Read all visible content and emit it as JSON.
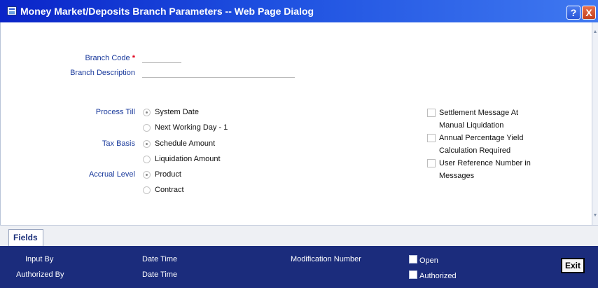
{
  "window": {
    "title": "Money Market/Deposits Branch Parameters -- Web Page Dialog",
    "help_label": "?",
    "close_label": "X"
  },
  "form": {
    "branch_code_label": "Branch Code",
    "required_marker": "*",
    "branch_code_value": "",
    "branch_description_label": "Branch Description",
    "branch_description_value": "",
    "process_till": {
      "label": "Process Till",
      "options": [
        "System Date",
        "Next Working Day - 1"
      ],
      "selected": "System Date"
    },
    "tax_basis": {
      "label": "Tax Basis",
      "options": [
        "Schedule Amount",
        "Liquidation Amount"
      ],
      "selected": "Schedule Amount"
    },
    "accrual_level": {
      "label": "Accrual Level",
      "options": [
        "Product",
        "Contract"
      ],
      "selected": "Product"
    },
    "checkboxes": [
      {
        "line1": "Settlement Message At",
        "line2": "Manual Liquidation",
        "checked": false
      },
      {
        "line1": "Annual Percentage Yield",
        "line2": "Calculation Required",
        "checked": false
      },
      {
        "line1": "User Reference Number in",
        "line2": "Messages",
        "checked": false
      }
    ]
  },
  "tabs": [
    {
      "label": "Fields",
      "active": true
    }
  ],
  "footer": {
    "input_by": "Input By",
    "authorized_by": "Authorized By",
    "date_time_1": "Date Time",
    "date_time_2": "Date Time",
    "modification_number": "Modification Number",
    "open_label": "Open",
    "authorized_label": "Authorized",
    "exit_label": "Exit"
  }
}
